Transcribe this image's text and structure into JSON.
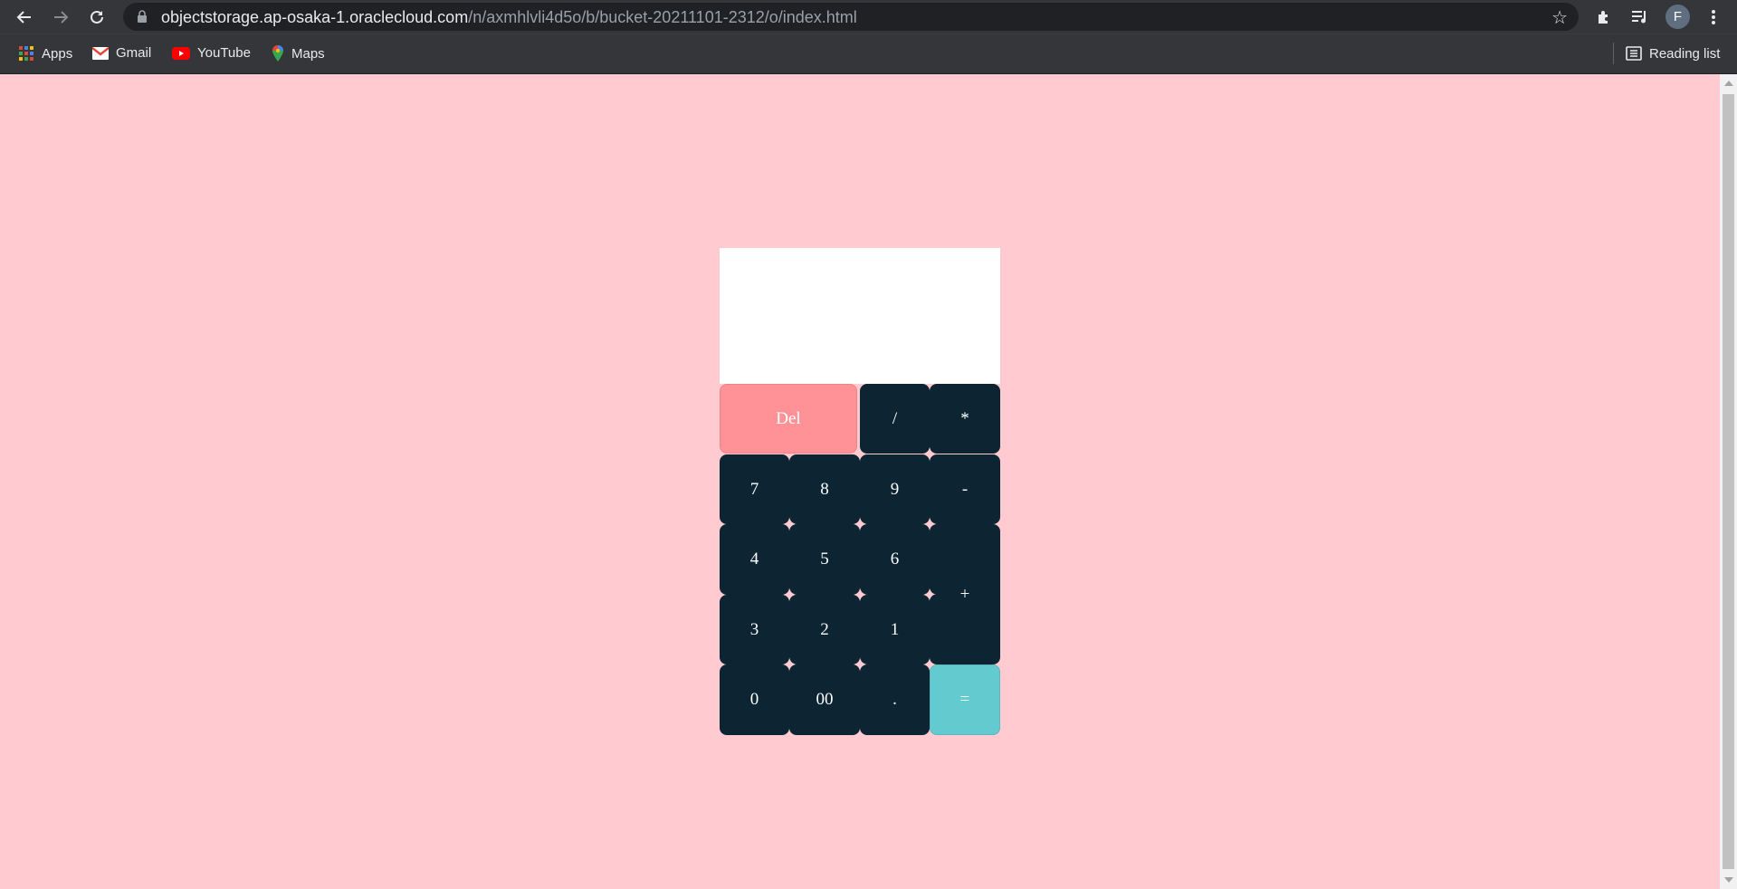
{
  "browser": {
    "url_host": "objectstorage.ap-osaka-1.oraclecloud.com",
    "url_path": "/n/axmhlvli4d5o/b/bucket-20211101-2312/o/index.html",
    "profile_initial": "F",
    "bookmarks": [
      {
        "label": "Apps",
        "icon": "apps-grid-icon"
      },
      {
        "label": "Gmail",
        "icon": "gmail-icon"
      },
      {
        "label": "YouTube",
        "icon": "youtube-icon"
      },
      {
        "label": "Maps",
        "icon": "maps-icon"
      }
    ],
    "reading_list": "Reading list"
  },
  "calculator": {
    "display": "",
    "keys": {
      "del": "Del",
      "divide": "/",
      "multiply": "*",
      "seven": "7",
      "eight": "8",
      "nine": "9",
      "minus": "-",
      "four": "4",
      "five": "5",
      "six": "6",
      "plus": "+",
      "three": "3",
      "two": "2",
      "one": "1",
      "zero": "0",
      "double_zero": "00",
      "dot": ".",
      "equals": "="
    }
  },
  "colors": {
    "page_background": "#ffcbd0",
    "key_dark": "#0d2533",
    "key_delete": "#ff9296",
    "key_equals": "#63cbcf"
  }
}
